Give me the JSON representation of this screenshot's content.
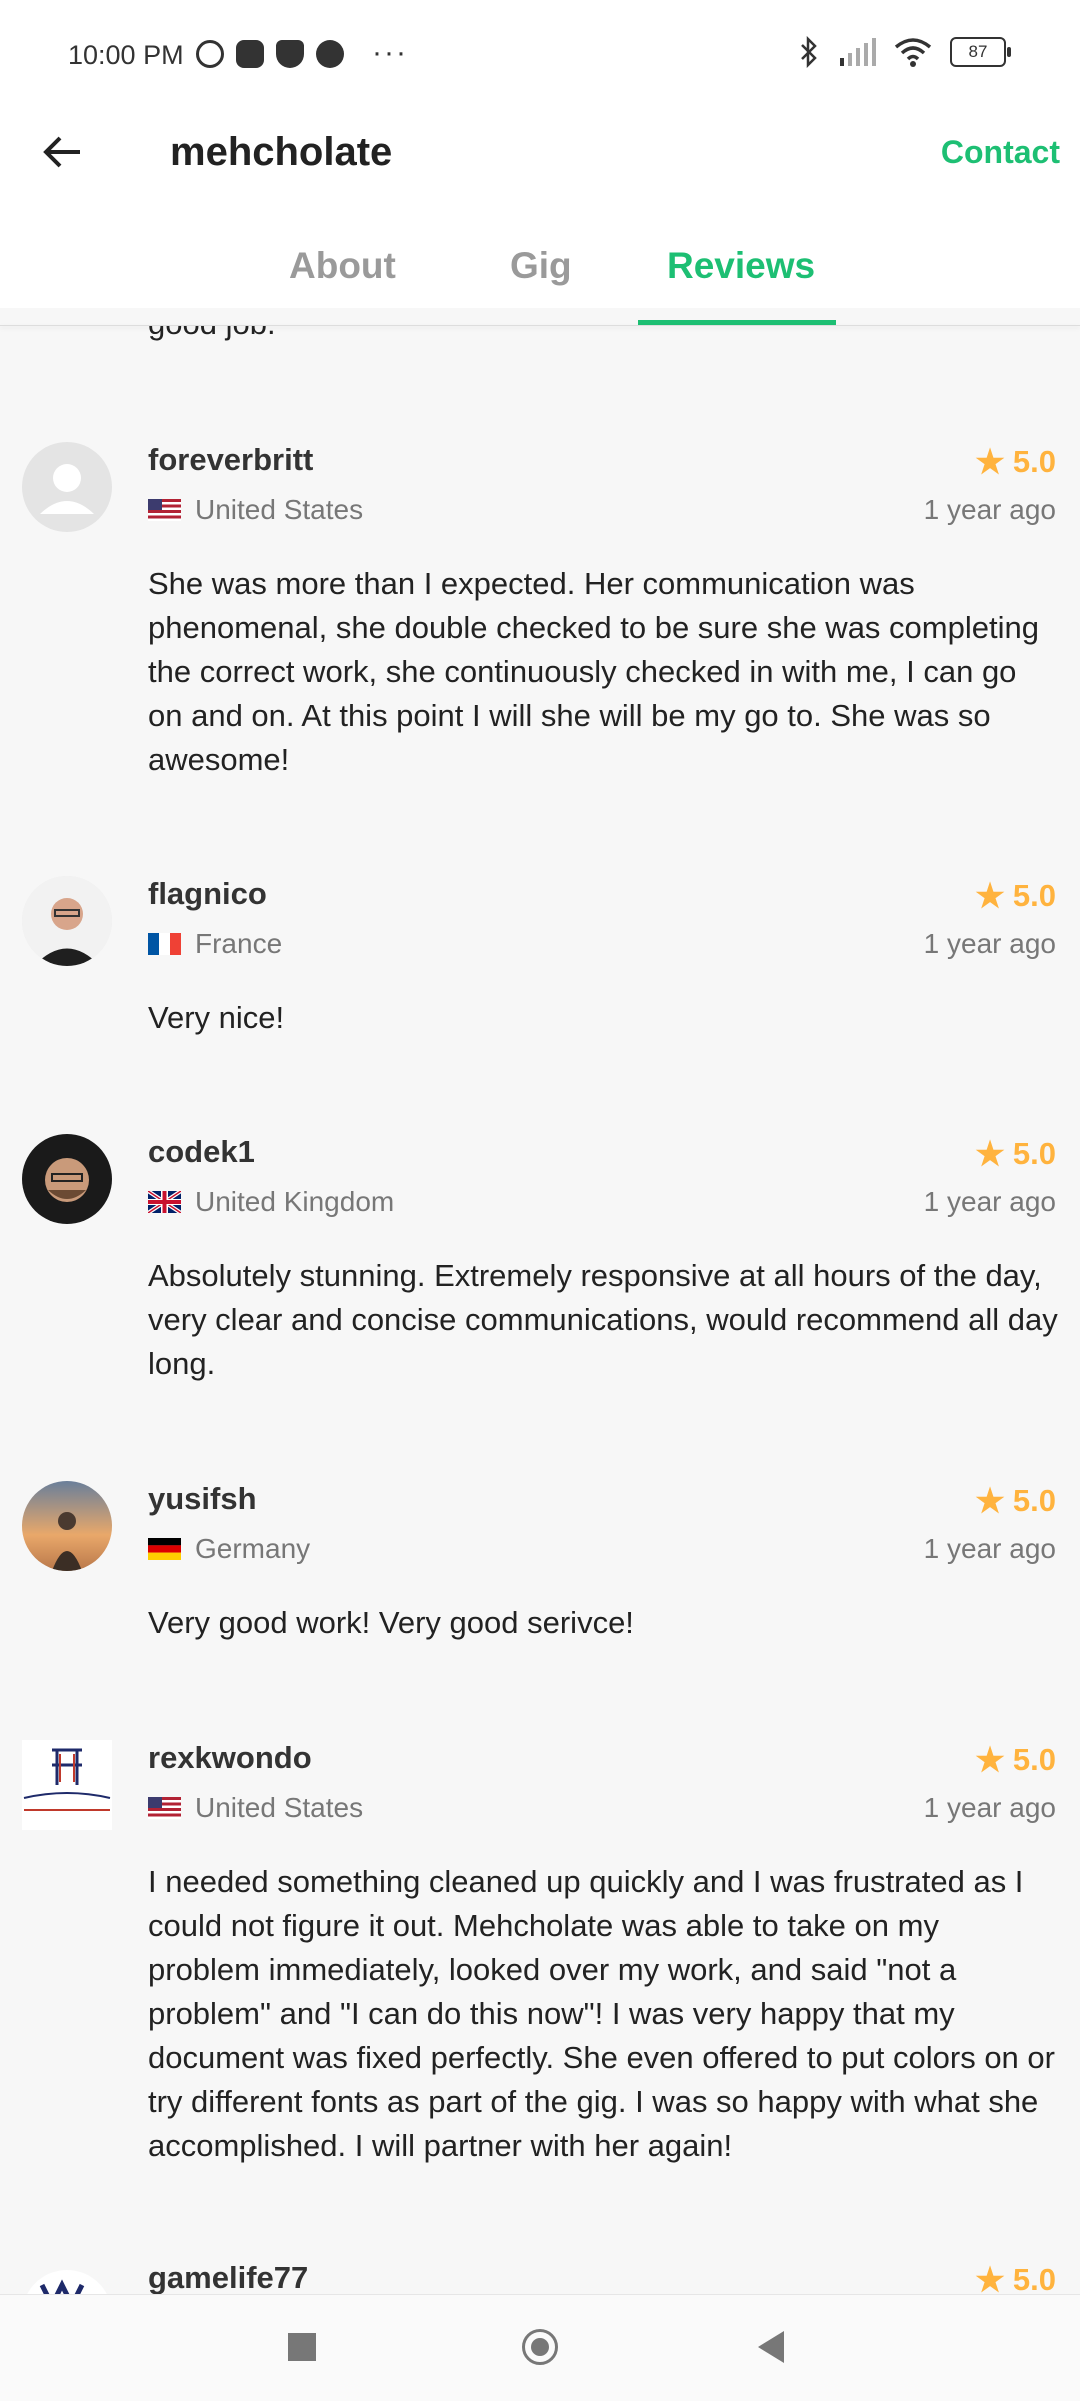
{
  "status_bar": {
    "time": "10:00 PM",
    "overflow": "···",
    "battery": "87",
    "icons": [
      "alarm-icon",
      "game-icon",
      "shield-icon",
      "media-icon",
      "bluetooth-icon",
      "signal-icon",
      "wifi-icon",
      "battery-icon"
    ]
  },
  "header": {
    "title": "mehcholate",
    "contact_label": "Contact"
  },
  "tabs": [
    {
      "label": "About",
      "active": false
    },
    {
      "label": "Gig",
      "active": false
    },
    {
      "label": "Reviews",
      "active": true
    }
  ],
  "reviews_partial_text": "good job.",
  "reviews": [
    {
      "username": "foreverbritt",
      "rating": "5.0",
      "country": "United States",
      "date": "1 year ago",
      "text": "She was more than I expected. Her communication was phenomenal, she double checked to be sure she was completing the correct work, she continuously checked in with me,  I can go on and on. At this point I will she will be my go to. She was so awesome!"
    },
    {
      "username": "flagnico",
      "rating": "5.0",
      "country": "France",
      "date": "1 year ago",
      "text": "Very nice!"
    },
    {
      "username": "codek1",
      "rating": "5.0",
      "country": "United Kingdom",
      "date": "1 year ago",
      "text": "Absolutely stunning.  Extremely responsive at all hours of the day, very clear and concise communications, would recommend all day long."
    },
    {
      "username": "yusifsh",
      "rating": "5.0",
      "country": "Germany",
      "date": "1 year ago",
      "text": "Very good work! Very good serivce!"
    },
    {
      "username": "rexkwondo",
      "rating": "5.0",
      "country": "United States",
      "date": "1 year ago",
      "text": "I needed something cleaned up quickly and I was frustrated as I could not figure it out. Mehcholate was able to take on my problem immediately, looked over my work, and said \"not a problem\" and  \"I can do this now\"!  I was very happy that my document was fixed perfectly. She even offered to put colors on or try different fonts as part of the gig.  I was so happy with what she accomplished. I will partner with her again!"
    },
    {
      "username": "gamelife77",
      "rating": "5.0",
      "country": "",
      "date": "",
      "text": ""
    }
  ],
  "colors": {
    "accent": "#1dbf73",
    "star": "#ffb33e",
    "background": "#f7f7f7"
  }
}
